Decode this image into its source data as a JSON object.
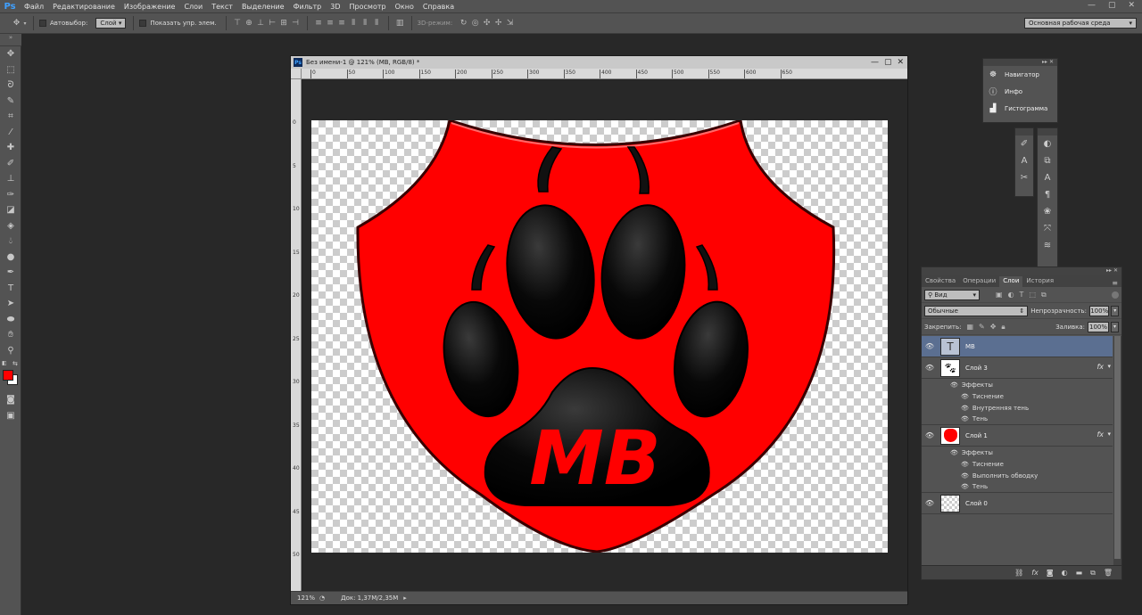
{
  "app": {
    "logo": "Ps"
  },
  "menu": [
    "Файл",
    "Редактирование",
    "Изображение",
    "Слои",
    "Текст",
    "Выделение",
    "Фильтр",
    "3D",
    "Просмотр",
    "Окно",
    "Справка"
  ],
  "window_controls": [
    "—",
    "▢",
    "✕"
  ],
  "options": {
    "autoselect_label": "Автовыбор:",
    "autoselect_value": "Слой",
    "show_transform_label": "Показать упр. элем.",
    "mode3d_label": "3D-режим:",
    "workspace": "Основная рабочая среда"
  },
  "tools": [
    "move-tool",
    "marquee-tool",
    "lasso-tool",
    "quick-select-tool",
    "crop-tool",
    "eyedropper-tool",
    "healing-tool",
    "brush-tool",
    "clone-stamp-tool",
    "history-brush-tool",
    "eraser-tool",
    "gradient-tool",
    "blur-tool",
    "dodge-tool",
    "pen-tool",
    "type-tool",
    "path-select-tool",
    "shape-tool",
    "hand-tool",
    "zoom-tool"
  ],
  "colors": {
    "foreground": "#ff0000",
    "background": "#ffffff",
    "accent_selected": "#5b6f91",
    "shield_red": "#ff0000"
  },
  "document": {
    "title": "Без имени-1 @ 121% (MB, RGB/8) *",
    "ruler_h": [
      "0",
      "50",
      "100",
      "150",
      "200",
      "250",
      "300",
      "350",
      "400",
      "450",
      "500",
      "550",
      "600",
      "650"
    ],
    "ruler_v": [
      "0",
      "5",
      "10",
      "15",
      "20",
      "25",
      "30",
      "35",
      "40",
      "45",
      "50"
    ],
    "canvas_text": "MB",
    "zoom": "121%",
    "doc_info": "Док: 1,37M/2,35M"
  },
  "mini_panel": [
    {
      "icon": "navigator-icon",
      "label": "Навигатор"
    },
    {
      "icon": "info-icon",
      "label": "Инфо"
    },
    {
      "icon": "histogram-icon",
      "label": "Гистограмма"
    }
  ],
  "layers_panel": {
    "tabs": [
      "Свойства",
      "Операции",
      "Слои",
      "История"
    ],
    "active_tab": "Слои",
    "filter_kind": "Вид",
    "blend_mode": "Обычные",
    "opacity_label": "Непрозрачность:",
    "opacity_value": "100%",
    "lock_label": "Закрепить:",
    "fill_label": "Заливка:",
    "fill_value": "100%",
    "layers": [
      {
        "name": "MB",
        "type": "text",
        "selected": true
      },
      {
        "name": "Слой 3",
        "type": "paw",
        "fx": "fx",
        "effects_label": "Эффекты",
        "effects": [
          "Тиснение",
          "Внутренняя тень",
          "Тень"
        ]
      },
      {
        "name": "Слой 1",
        "type": "red",
        "fx": "fx",
        "effects_label": "Эффекты",
        "effects": [
          "Тиснение",
          "Выполнить обводку",
          "Тень"
        ]
      },
      {
        "name": "Слой 0",
        "type": "transparent"
      }
    ]
  }
}
